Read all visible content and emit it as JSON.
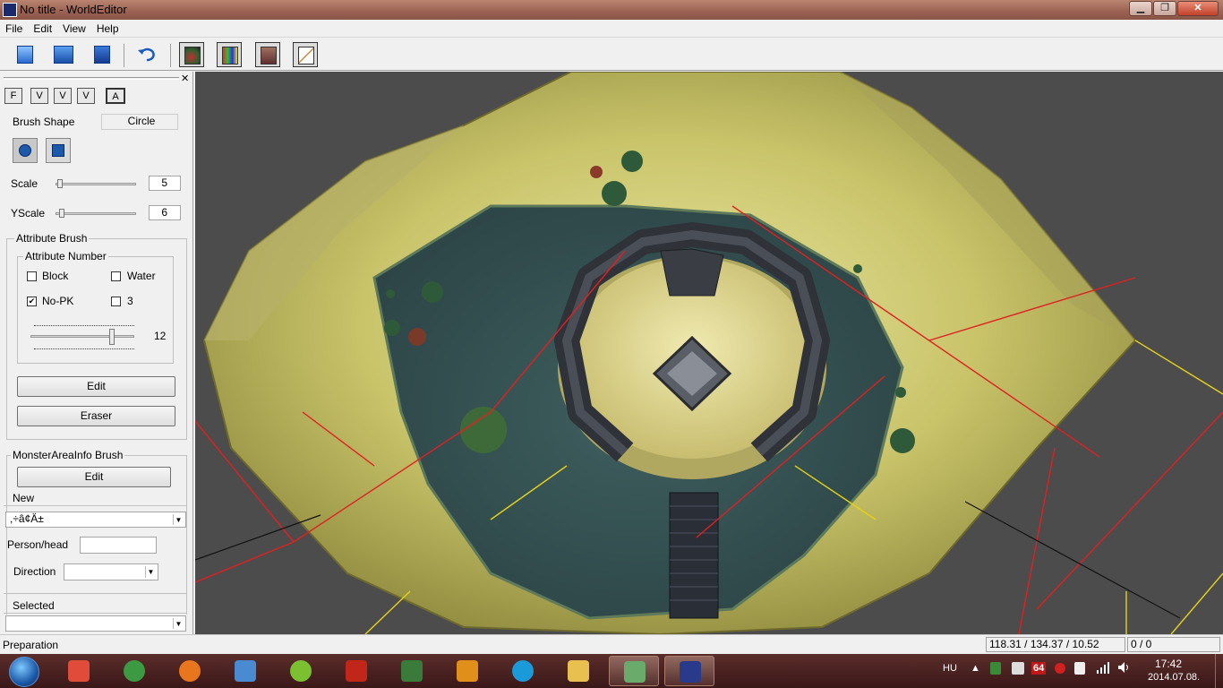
{
  "window": {
    "title": "No title - WorldEditor",
    "controls": [
      "▁",
      "❐",
      "✕"
    ]
  },
  "menu": [
    "File",
    "Edit",
    "View",
    "Help"
  ],
  "toolbar": {
    "icons": [
      "new-file-icon",
      "open-folder-icon",
      "save-icon",
      "undo-icon",
      "terrain-view-icon",
      "color-map-icon",
      "texture-icon",
      "brush-edit-icon"
    ]
  },
  "panel": {
    "close_glyph": "✕",
    "tabs": [
      "F",
      "V",
      "V",
      "V",
      "A"
    ],
    "brush_shape_label": "Brush Shape",
    "brush_shape_value": "Circle",
    "scale_label": "Scale",
    "scale_value": "5",
    "yscale_label": "YScale",
    "yscale_value": "6",
    "attribute_brush_label": "Attribute Brush",
    "attribute_number_label": "Attribute Number",
    "checkboxes": [
      {
        "label": "Block",
        "checked": false
      },
      {
        "label": "Water",
        "checked": false
      },
      {
        "label": "No-PK",
        "checked": true
      },
      {
        "label": "3",
        "checked": false
      }
    ],
    "attr_slider_value": "12",
    "edit_label": "Edit",
    "eraser_label": "Eraser",
    "monster_label": "MonsterAreaInfo Brush",
    "monster_edit_label": "Edit",
    "new_label": "New",
    "new_value": ",÷â¢Ä±",
    "person_label": "Person/head",
    "person_value": "",
    "direction_label": "Direction",
    "direction_value": "",
    "selected_label": "Selected",
    "selected_value": ""
  },
  "status": {
    "text": "Preparation",
    "coords": "118.31 / 134.37 / 10.52",
    "count": "0 / 0"
  },
  "taskbar": {
    "apps": [
      {
        "name": "apps-grid-icon",
        "color": "#e04b3a"
      },
      {
        "name": "chrome-icon",
        "color": "#3c9a42"
      },
      {
        "name": "firefox-icon",
        "color": "#e8761c"
      },
      {
        "name": "media-player-icon",
        "color": "#4a8ad0"
      },
      {
        "name": "leaf-app-icon",
        "color": "#7ac030"
      },
      {
        "name": "filezilla-icon",
        "color": "#c0261a"
      },
      {
        "name": "notepad-icon",
        "color": "#3a7a3a"
      },
      {
        "name": "sublime-icon",
        "color": "#e0901a"
      },
      {
        "name": "skype-icon",
        "color": "#1a9ad8"
      },
      {
        "name": "explorer-folder-icon",
        "color": "#e8c050"
      },
      {
        "name": "turtle-app-icon",
        "color": "#6aaa6a"
      },
      {
        "name": "worldeditor-task-icon",
        "color": "#2a3a8a"
      }
    ],
    "lang": "HU",
    "tray_badge": "64",
    "time": "17:42",
    "date": "2014.07.08."
  }
}
